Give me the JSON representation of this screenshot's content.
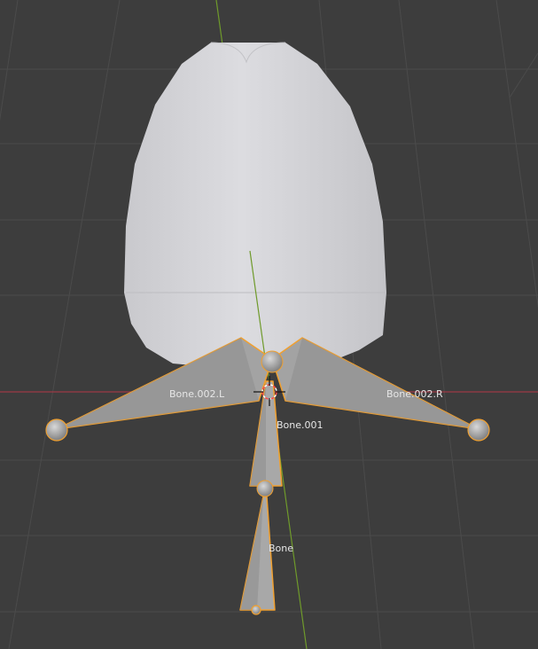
{
  "viewport": {
    "background": "#3d3d3d",
    "grid_color": "#4a4a4a",
    "x_axis_color": "#9c3a45",
    "y_axis_color": "#6f9a2b",
    "mesh_color": "#cfcfd3",
    "bone_fill": "#9a9a9a",
    "bone_outline": "#f0a030",
    "joint_color": "#a8a8a8"
  },
  "bones": [
    {
      "name": "Bone.002.L",
      "selected": true
    },
    {
      "name": "Bone.002.R",
      "selected": true
    },
    {
      "name": "Bone.001",
      "selected": true
    },
    {
      "name": "Bone",
      "selected": true
    }
  ],
  "objects": {
    "mesh_icon": "egg-shaped mesh",
    "cursor_icon": "3d-cursor"
  }
}
